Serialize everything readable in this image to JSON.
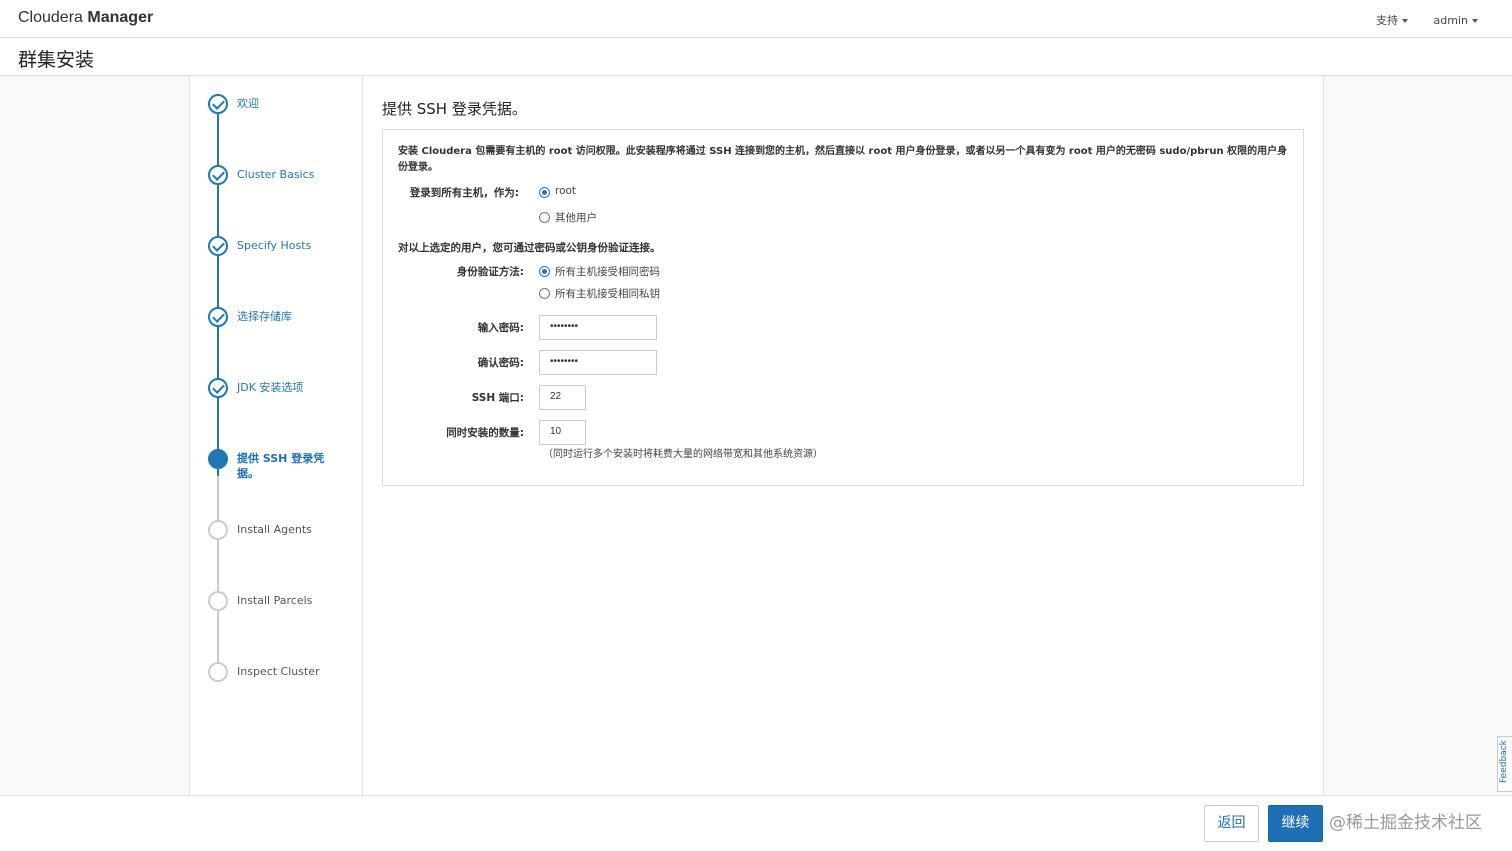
{
  "header": {
    "brand_light": "Cloudera",
    "brand_strong": "Manager",
    "nav_support": "支持",
    "nav_user": "admin"
  },
  "page_title": "群集安装",
  "steps": [
    {
      "label": "欢迎",
      "state": "done"
    },
    {
      "label": "Cluster Basics",
      "state": "done"
    },
    {
      "label": "Specify Hosts",
      "state": "done"
    },
    {
      "label": "选择存储库",
      "state": "done"
    },
    {
      "label": "JDK 安装选项",
      "state": "done"
    },
    {
      "label": "提供 SSH 登录凭据。",
      "state": "active"
    },
    {
      "label": "Install Agents",
      "state": "pending"
    },
    {
      "label": "Install Parcels",
      "state": "pending"
    },
    {
      "label": "Inspect Cluster",
      "state": "pending"
    }
  ],
  "content": {
    "section_title": "提供 SSH 登录凭据。",
    "intro": "安装 Cloudera 包需要有主机的 root 访问权限。此安装程序将通过 SSH 连接到您的主机，然后直接以 root 用户身份登录，或者以另一个具有变为 root 用户的无密码 sudo/pbrun 权限的用户身份登录。",
    "login_label": "登录到所有主机，作为:",
    "login_options": [
      "root",
      "其他用户"
    ],
    "auth_note": "对以上选定的用户，您可通过密码或公钥身份验证连接。",
    "auth_label": "身份验证方法:",
    "auth_options": [
      "所有主机接受相同密码",
      "所有主机接受相同私钥"
    ],
    "password_label": "输入密码:",
    "password_value": "••••••••",
    "confirm_label": "确认密码:",
    "confirm_value": "••••••••",
    "ssh_port_label": "SSH 端口:",
    "ssh_port_value": "22",
    "concurrent_label": "同时安装的数量:",
    "concurrent_value": "10",
    "concurrent_hint": "（同时运行多个安装时将耗费大量的网络带宽和其他系统资源）"
  },
  "footer": {
    "back_label": "返回",
    "next_label": "继续",
    "watermark": "@稀土掘金技术社区"
  },
  "feedback_label": "Feedback",
  "colors": {
    "accent": "#1f6fb4",
    "pending": "#cccccc"
  }
}
